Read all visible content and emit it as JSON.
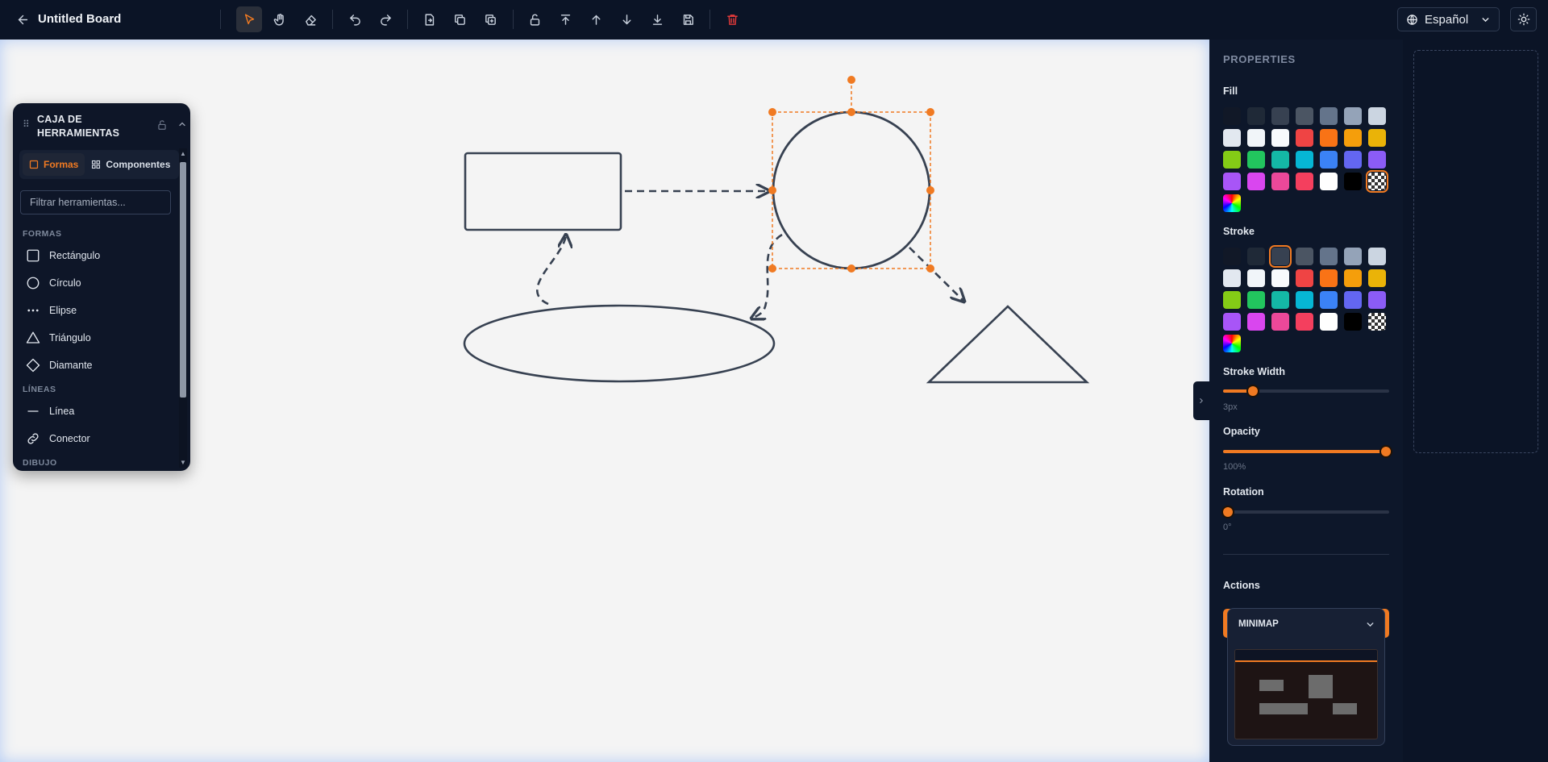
{
  "header": {
    "board_title": "Untitled Board",
    "language": "Español",
    "tools": [
      {
        "name": "back-icon"
      },
      {
        "name": "select-pointer-icon",
        "active": true
      },
      {
        "name": "hand-pan-icon"
      },
      {
        "name": "eraser-icon"
      },
      {
        "name": "undo-icon"
      },
      {
        "name": "redo-icon"
      },
      {
        "name": "export-icon"
      },
      {
        "name": "copy-icon"
      },
      {
        "name": "duplicate-icon"
      },
      {
        "name": "unlock-icon"
      },
      {
        "name": "bring-to-front-icon"
      },
      {
        "name": "bring-forward-icon"
      },
      {
        "name": "send-backward-icon"
      },
      {
        "name": "send-to-back-icon"
      },
      {
        "name": "save-icon"
      },
      {
        "name": "trash-icon"
      },
      {
        "name": "globe-icon"
      },
      {
        "name": "theme-sun-icon"
      }
    ]
  },
  "toolbox": {
    "title": "CAJA DE HERRAMIENTAS",
    "tabs": [
      {
        "label": "Formas",
        "active": true
      },
      {
        "label": "Componentes",
        "active": false
      }
    ],
    "filter_placeholder": "Filtrar herramientas...",
    "sections": [
      {
        "title": "FORMAS",
        "items": [
          "Rectángulo",
          "Círculo",
          "Elipse",
          "Triángulo",
          "Diamante"
        ]
      },
      {
        "title": "LÍNEAS",
        "items": [
          "Línea",
          "Conector"
        ]
      },
      {
        "title": "DIBUJO",
        "items": []
      }
    ]
  },
  "properties": {
    "title": "PROPERTIES",
    "fill_label": "Fill",
    "stroke_label": "Stroke",
    "stroke_width_label": "Stroke Width",
    "stroke_width_value": "3px",
    "stroke_width_fraction": 0.18,
    "opacity_label": "Opacity",
    "opacity_value": "100%",
    "opacity_fraction": 1.0,
    "rotation_label": "Rotation",
    "rotation_value": "0°",
    "rotation_fraction": 0.0,
    "actions_label": "Actions",
    "palette": [
      "#111827",
      "#1f2937",
      "#374151",
      "#4b5563",
      "#64748b",
      "#94a3b8",
      "#cbd5e1",
      "#e2e8f0",
      "#f1f5f9",
      "#f8fafc",
      "#ef4444",
      "#f97316",
      "#f59e0b",
      "#eab308",
      "#84cc16",
      "#22c55e",
      "#14b8a6",
      "#06b6d4",
      "#3b82f6",
      "#6366f1",
      "#8b5cf6",
      "#a855f7",
      "#d946ef",
      "#ec4899",
      "#f43f5e",
      "#ffffff",
      "#000000",
      "transparent",
      "custom"
    ],
    "fill_selected_index": 27,
    "stroke_selected_index": 2
  },
  "minimap": {
    "title": "MINIMAP"
  },
  "colors": {
    "accent": "#f07a22",
    "shape_stroke": "#374151",
    "canvas": "#f4f4f4"
  }
}
